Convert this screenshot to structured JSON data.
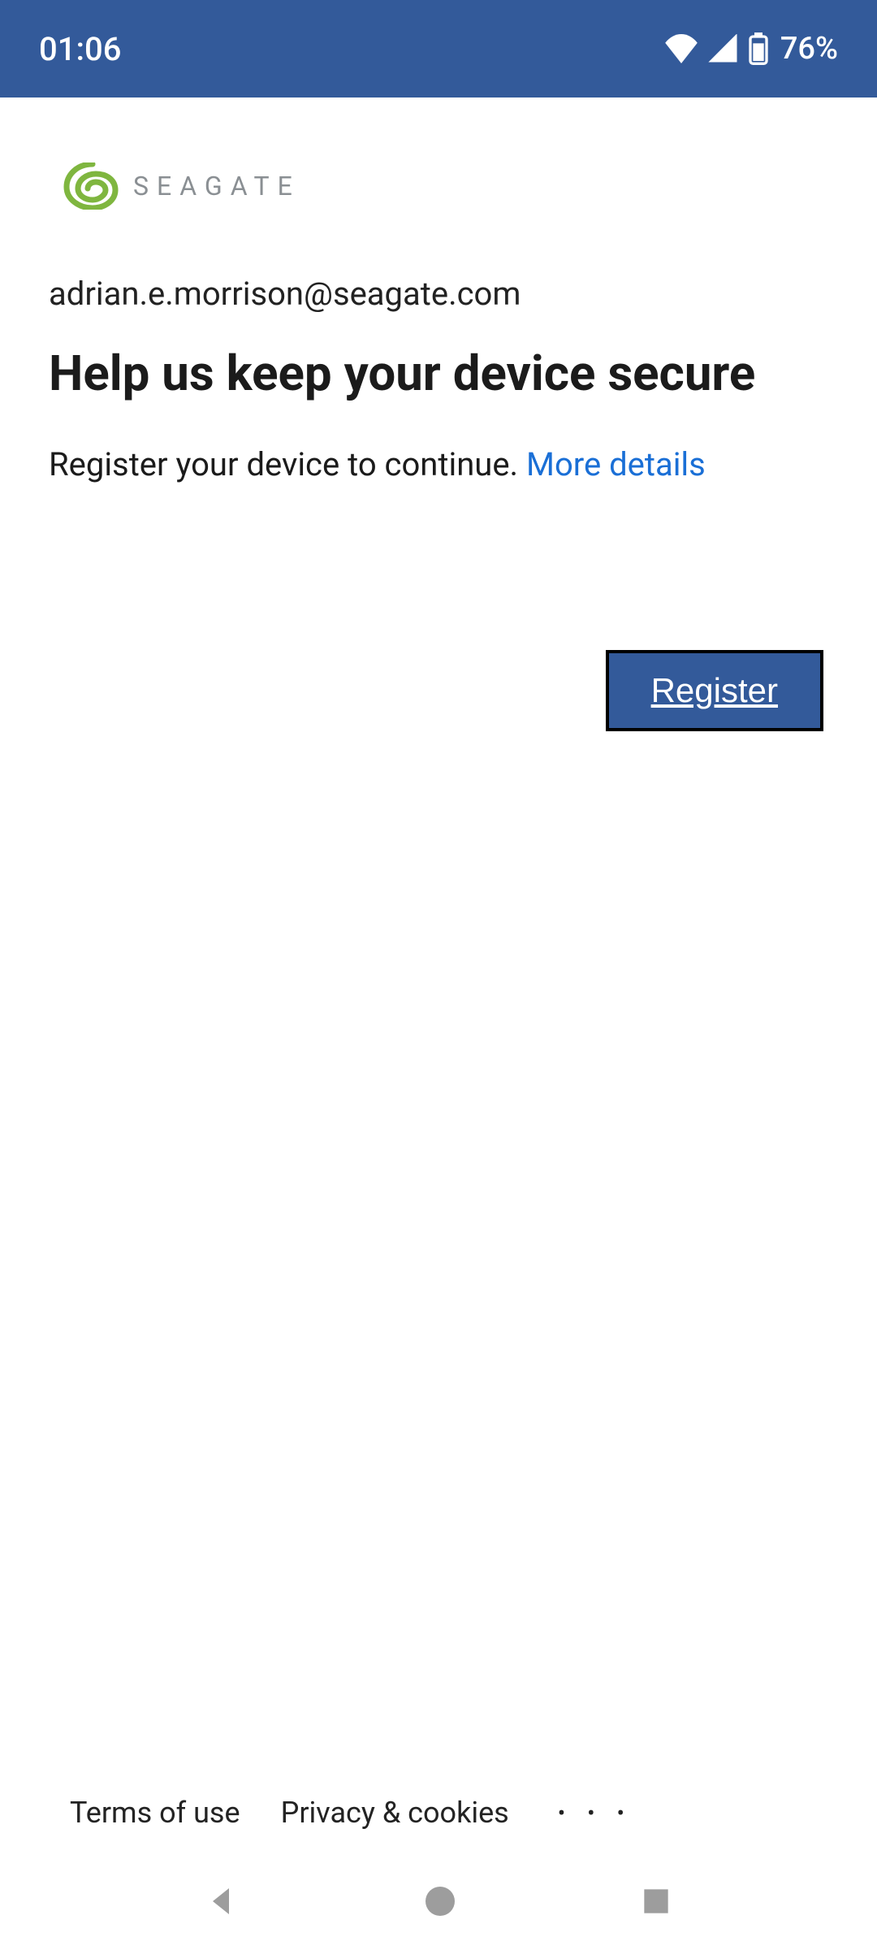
{
  "status": {
    "time": "01:06",
    "battery_percent": "76%"
  },
  "brand": {
    "name": "SEAGATE"
  },
  "main": {
    "email": "adrian.e.morrison@seagate.com",
    "heading": "Help us keep your device secure",
    "subtext": "Register your device to continue. ",
    "more_details_label": "More details",
    "register_label": "Register"
  },
  "footer": {
    "terms_label": "Terms of use",
    "privacy_label": "Privacy & cookies",
    "more_label": "• • •"
  }
}
